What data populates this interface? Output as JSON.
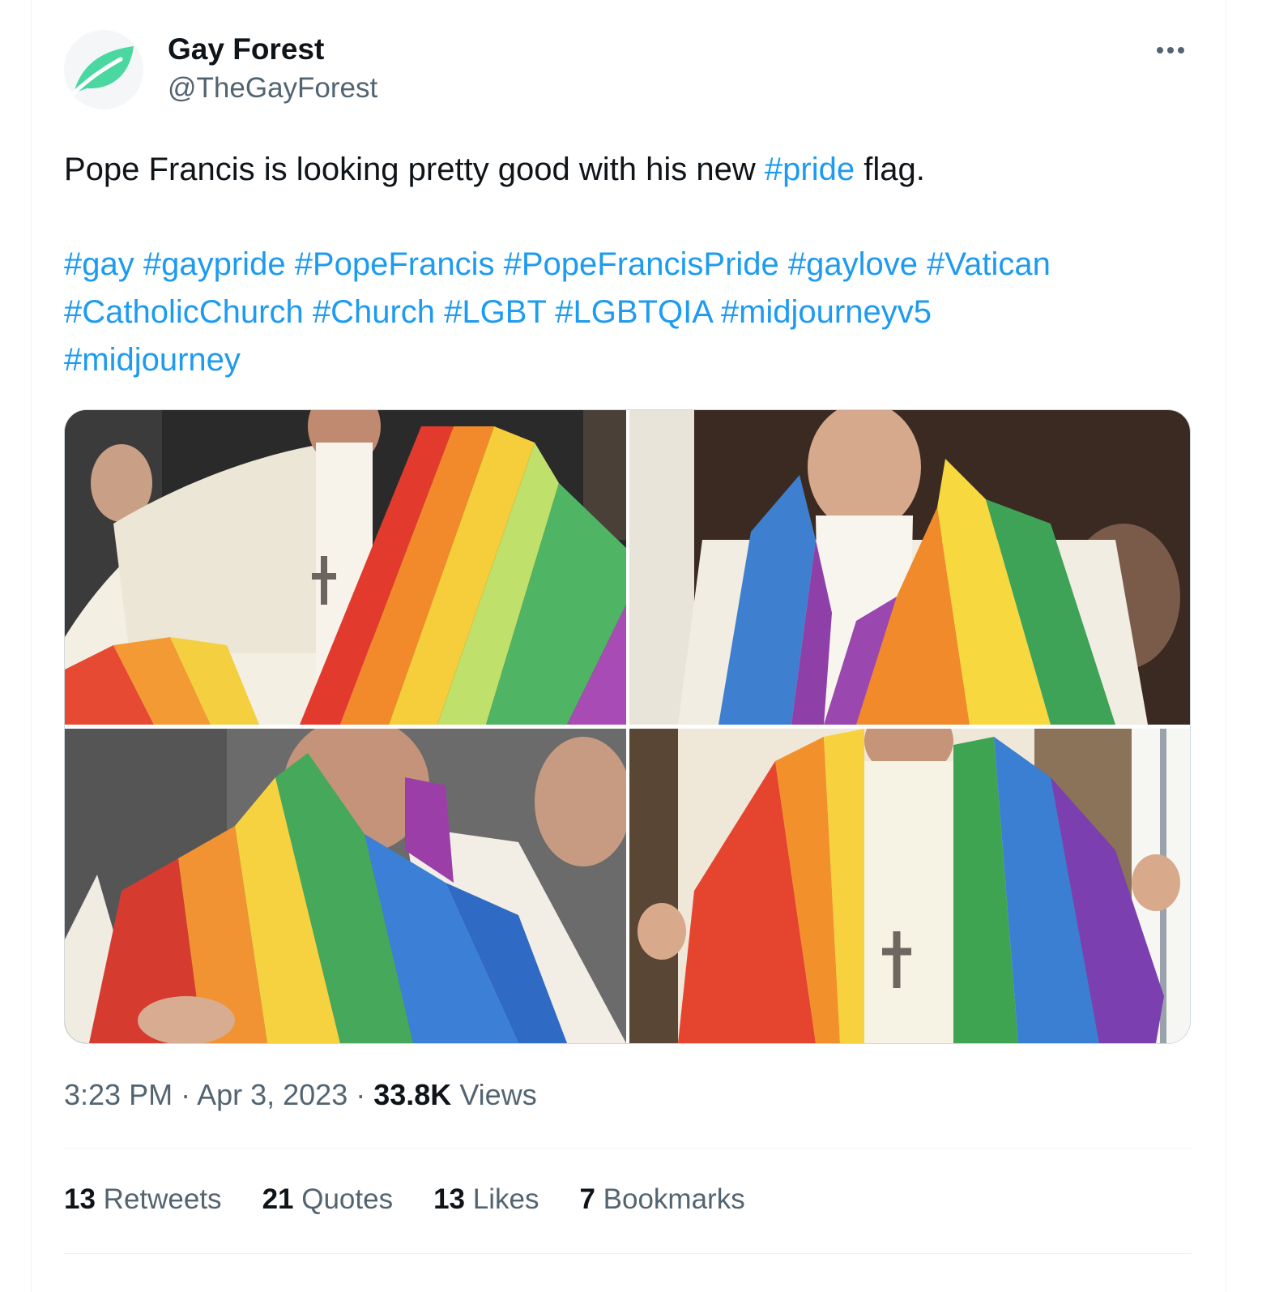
{
  "tweet": {
    "author": {
      "name": "Gay Forest",
      "handle": "@TheGayForest",
      "avatar_icon": "green-leaf-icon"
    },
    "text_before": "Pope Francis is looking pretty good with his new ",
    "text_hashtag": "#pride",
    "text_after": " flag.",
    "hashtags": [
      "#gay",
      "#gaypride",
      "#PopeFrancis",
      "#PopeFrancisPride",
      "#gaylove",
      "#Vatican",
      "#CatholicChurch",
      "#Church",
      "#LGBT",
      "#LGBTQIA",
      "#midjourneyv5",
      "#midjourney"
    ],
    "time": "3:23 PM",
    "sep": " · ",
    "date": "Apr 3, 2023",
    "views_count": "33.8K",
    "views_label": " Views",
    "stats": {
      "retweets_count": "13",
      "retweets_label": " Retweets",
      "quotes_count": "21",
      "quotes_label": " Quotes",
      "likes_count": "13",
      "likes_label": " Likes",
      "bookmarks_count": "7",
      "bookmarks_label": " Bookmarks"
    },
    "more_icon": "ellipsis-icon",
    "media_count": 4
  },
  "colors": {
    "accent": "#1d9bf0",
    "text_primary": "#0f1419",
    "text_secondary": "#536471",
    "leaf": "#4ad8a0"
  }
}
